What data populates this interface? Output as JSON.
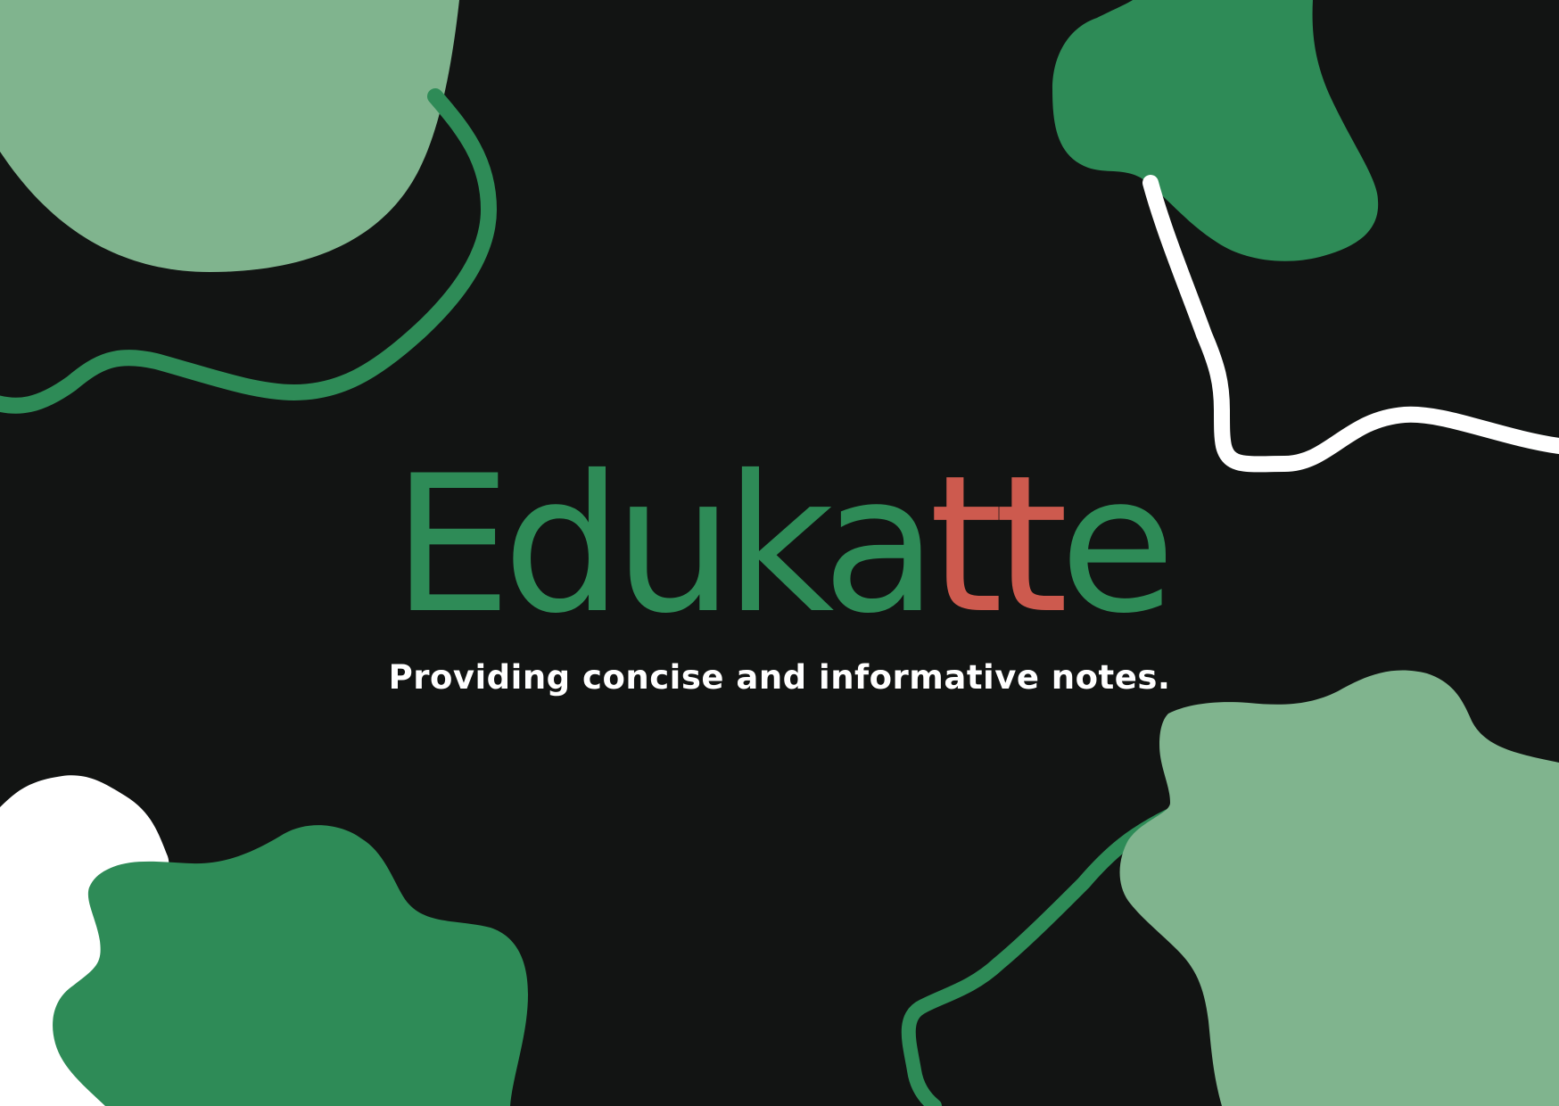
{
  "brand": {
    "title_segments": [
      {
        "text": "Eduka",
        "color": "#2e8b57"
      },
      {
        "text": "tt",
        "color": "#cd5a4e"
      },
      {
        "text": "e",
        "color": "#2e8b57"
      }
    ]
  },
  "tagline": "Providing concise and informative notes.",
  "colors": {
    "background": "#121413",
    "dark_green": "#2e8b57",
    "light_green": "#80b48e",
    "red": "#cd5a4e",
    "white": "#ffffff"
  }
}
